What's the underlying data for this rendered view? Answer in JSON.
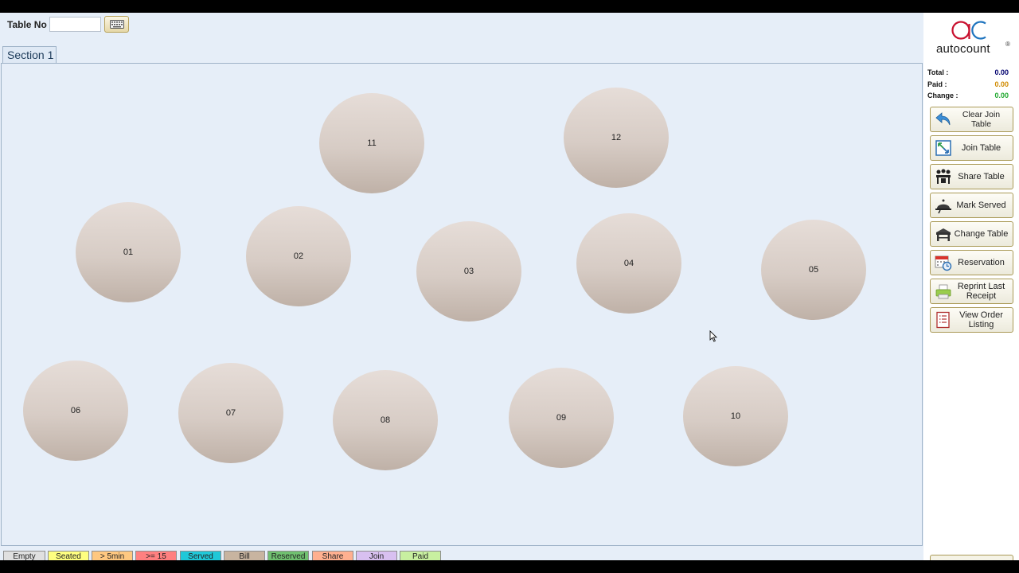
{
  "header": {
    "table_no_label": "Table No",
    "table_no_value": ""
  },
  "section_tab": {
    "label": "Section 1"
  },
  "tables": [
    "11",
    "12",
    "01",
    "02",
    "03",
    "04",
    "05",
    "06",
    "07",
    "08",
    "09",
    "10"
  ],
  "brand": {
    "name": "autocount",
    "mark": "®"
  },
  "summary": {
    "total_label": "Total :",
    "total_value": "0.00",
    "paid_label": "Paid :",
    "paid_value": "0.00",
    "change_label": "Change :",
    "change_value": "0.00"
  },
  "actions": {
    "clear_join_table": "Clear Join Table",
    "join_table": "Join Table",
    "share_table": "Share Table",
    "mark_served": "Mark Served",
    "change_table": "Change Table",
    "reservation": "Reservation",
    "reprint_last_receipt": "Reprint Last Receipt",
    "view_order_listing": "View Order Listing"
  },
  "legend": [
    "Empty",
    "Seated",
    "> 5min",
    ">= 15",
    "Served",
    "Bill",
    "Reserved",
    "Share",
    "Join",
    "Paid"
  ],
  "colors": {
    "total": "#00006e",
    "paid": "#d08a00",
    "change": "#1fa82e",
    "legend_empty": "#e0e0e0",
    "legend_seated": "#ffff80",
    "legend_5min": "#ffc880",
    "legend_15": "#ff8080",
    "legend_served": "#20c8d8",
    "legend_bill": "#c8b4a0",
    "legend_reserved": "#70c070",
    "legend_share": "#ffb090",
    "legend_join": "#d8c0f0",
    "legend_paid": "#c8f0a0"
  }
}
